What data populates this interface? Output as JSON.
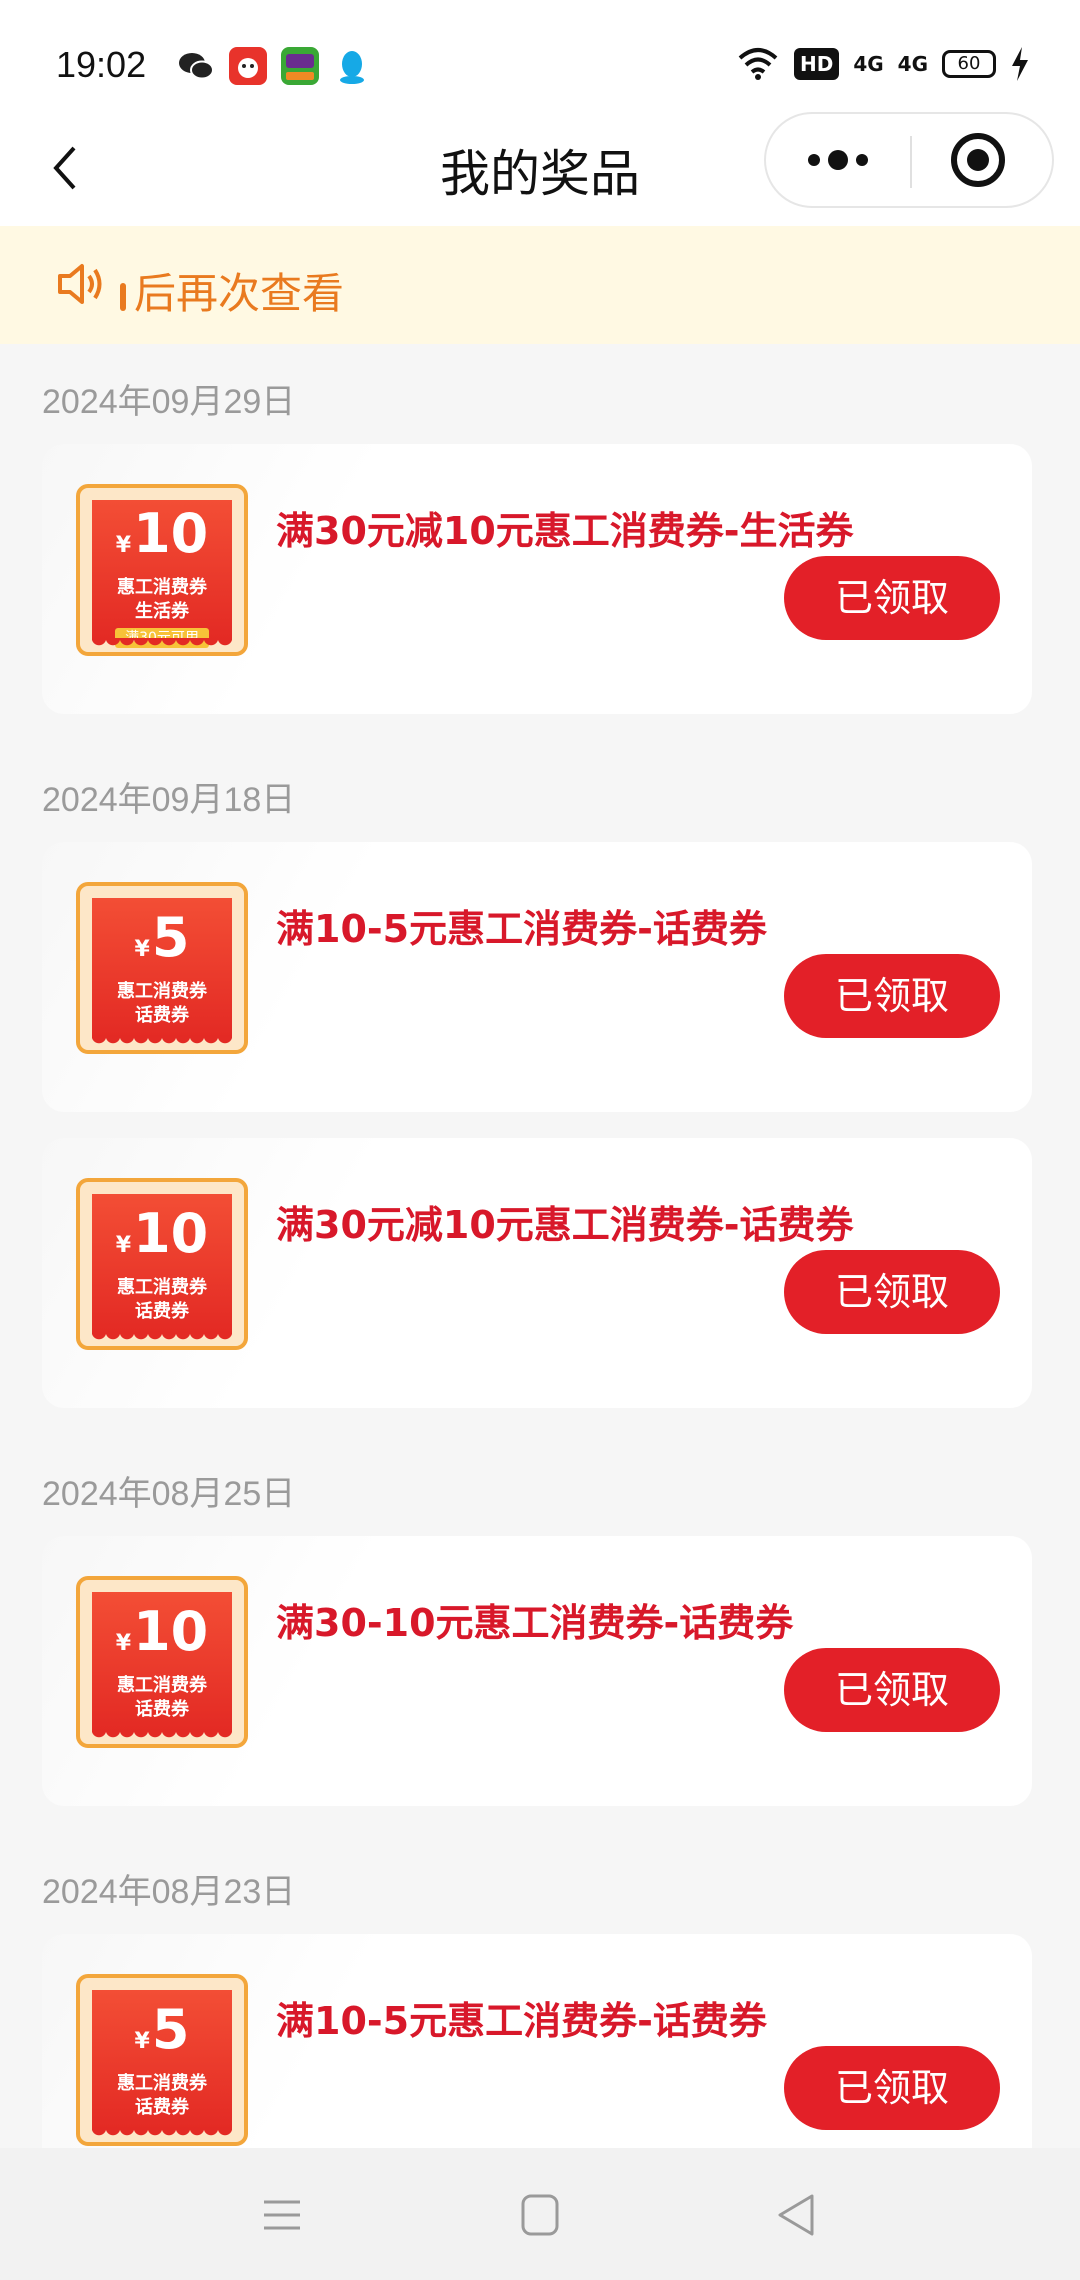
{
  "status_bar": {
    "time": "19:02",
    "wifi_icon": "wifi-icon",
    "hd_label": "HD",
    "signal1": "4G",
    "signal2": "4G",
    "battery": "60"
  },
  "nav": {
    "title": "我的奖品",
    "back_icon": "chevron-left-icon",
    "more_icon": "more-dots-icon",
    "close_icon": "target-circle-icon"
  },
  "notice": {
    "icon": "speaker-icon",
    "text": "后再次查看"
  },
  "groups": [
    {
      "date": "2024年09月29日",
      "items": [
        {
          "amount": "10",
          "line1": "惠工消费券",
          "line2": "生活券",
          "tag": "满30元可用",
          "name": "满30元减10元惠工消费券-生活券",
          "button": "已领取"
        }
      ]
    },
    {
      "date": "2024年09月18日",
      "items": [
        {
          "amount": "5",
          "line1": "惠工消费券",
          "line2": "话费券",
          "name": "满10-5元惠工消费券-话费券",
          "button": "已领取"
        },
        {
          "amount": "10",
          "line1": "惠工消费券",
          "line2": "话费券",
          "name": "满30元减10元惠工消费券-话费券",
          "button": "已领取"
        }
      ]
    },
    {
      "date": "2024年08月25日",
      "items": [
        {
          "amount": "10",
          "line1": "惠工消费券",
          "line2": "话费券",
          "name": "满30-10元惠工消费券-话费券",
          "button": "已领取"
        }
      ]
    },
    {
      "date": "2024年08月23日",
      "items": [
        {
          "amount": "5",
          "line1": "惠工消费券",
          "line2": "话费券",
          "name": "满10-5元惠工消费券-话费券",
          "button": "已领取"
        }
      ]
    }
  ],
  "coupon_currency": "¥",
  "colors": {
    "accent_red": "#e32028",
    "prize_text": "#d8182a",
    "notice_text": "#e97a1f",
    "notice_bg": "#fff9e3"
  }
}
